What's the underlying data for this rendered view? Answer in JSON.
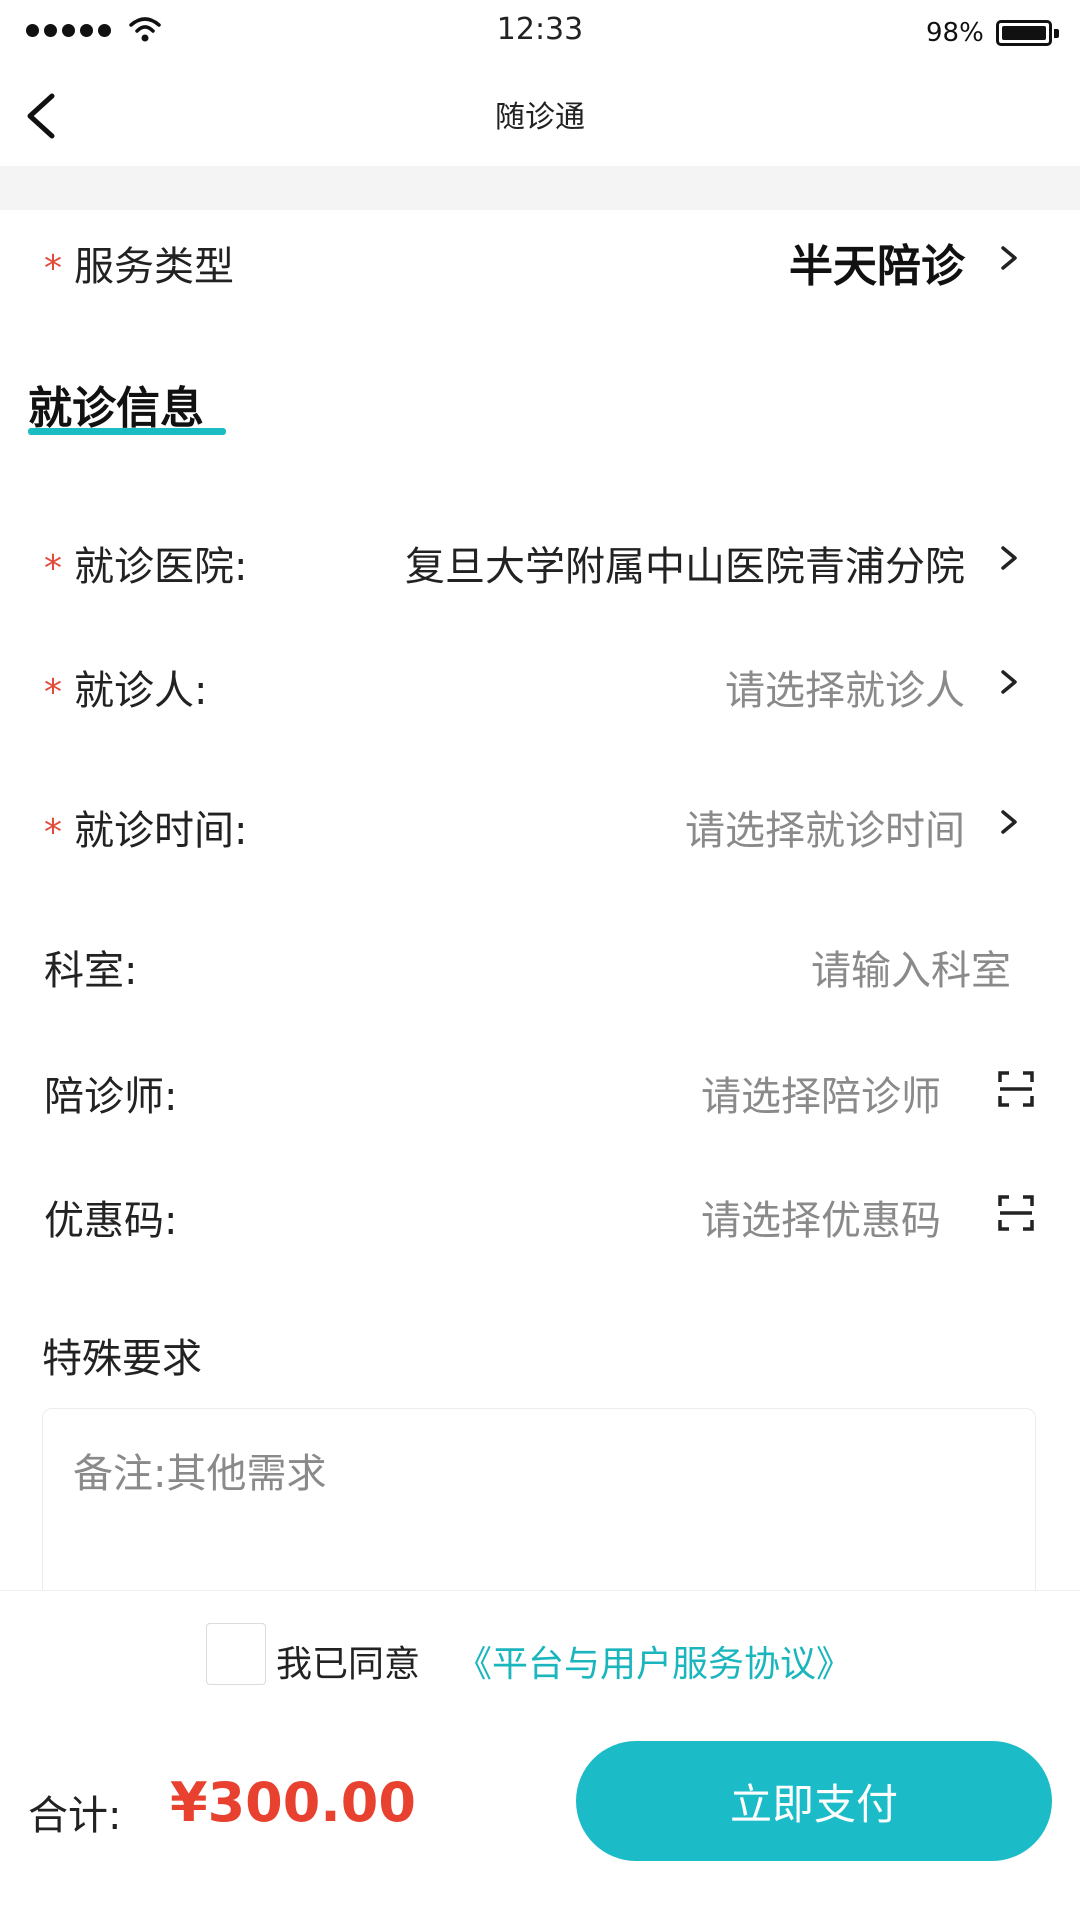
{
  "status_bar": {
    "time": "12:33",
    "battery": "98%"
  },
  "nav": {
    "title": "随诊通"
  },
  "service": {
    "label": "服务类型",
    "value": "半天陪诊"
  },
  "section_title": "就诊信息",
  "fields": {
    "hospital": {
      "label": "就诊医院:",
      "value": "复旦大学附属中山医院青浦分院"
    },
    "patient": {
      "label": "就诊人:",
      "placeholder": "请选择就诊人"
    },
    "time": {
      "label": "就诊时间:",
      "placeholder": "请选择就诊时间"
    },
    "department": {
      "label": "科室:",
      "placeholder": "请输入科室"
    },
    "escort": {
      "label": "陪诊师:",
      "placeholder": "请选择陪诊师"
    },
    "coupon": {
      "label": "优惠码:",
      "placeholder": "请选择优惠码"
    }
  },
  "special": {
    "label": "特殊要求",
    "placeholder": "备注:其他需求"
  },
  "required_mark": "*",
  "agreement": {
    "text": "我已同意",
    "link": "《平台与用户服务协议》",
    "checked": false
  },
  "total": {
    "label": "合计:",
    "amount": "¥300.00"
  },
  "pay_button": "立即支付",
  "colors": {
    "accent": "#1bbcc8",
    "price": "#e8412f",
    "required": "#e34a3a"
  }
}
